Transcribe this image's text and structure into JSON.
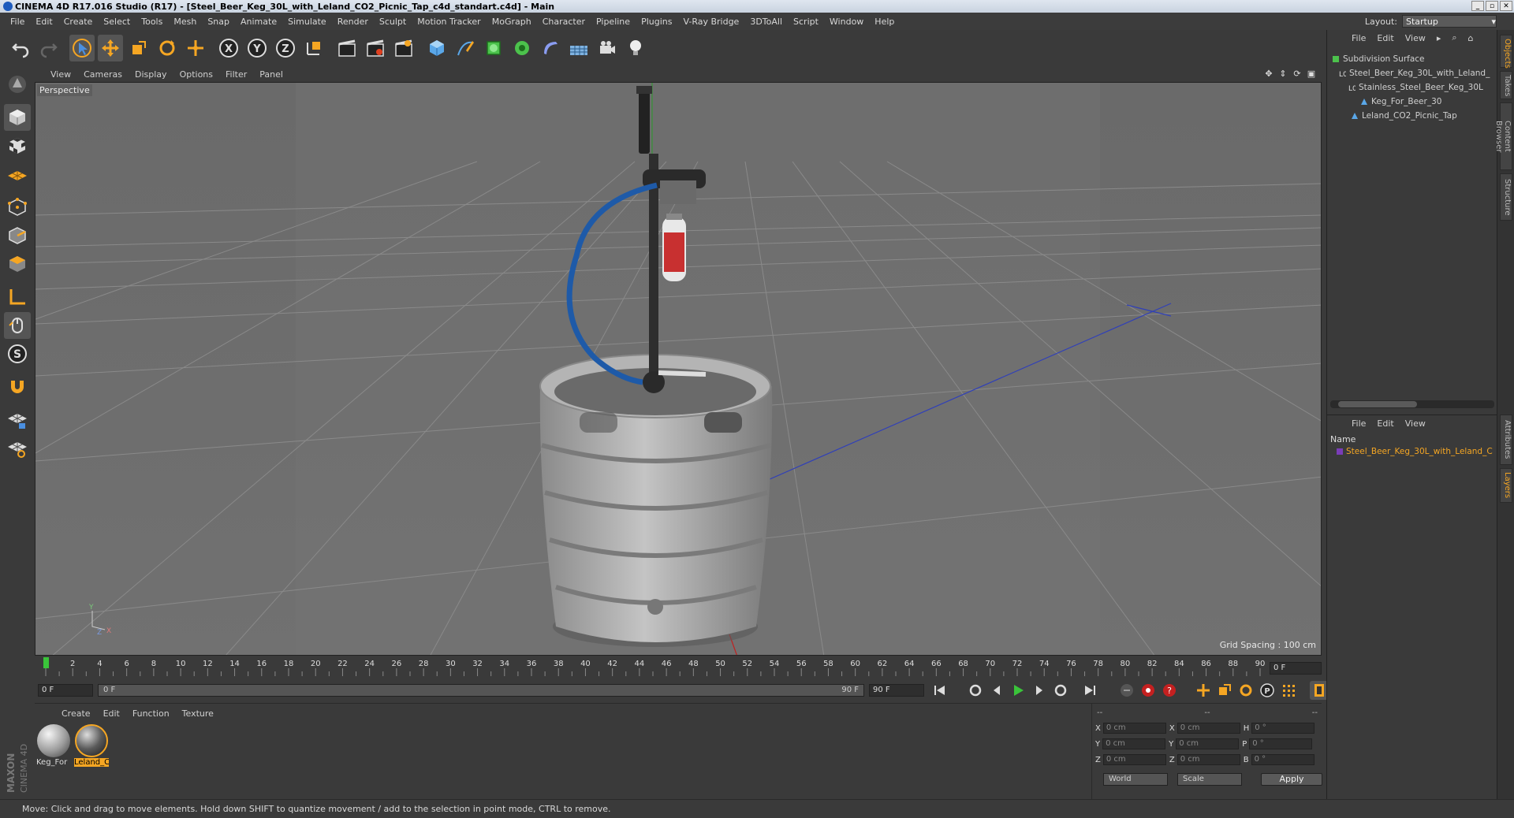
{
  "window": {
    "title": "CINEMA 4D R17.016 Studio (R17) - [Steel_Beer_Keg_30L_with_Leland_CO2_Picnic_Tap_c4d_standart.c4d] - Main"
  },
  "menubar": {
    "items": [
      "File",
      "Edit",
      "Create",
      "Select",
      "Tools",
      "Mesh",
      "Snap",
      "Animate",
      "Simulate",
      "Render",
      "Sculpt",
      "Motion Tracker",
      "MoGraph",
      "Character",
      "Pipeline",
      "Plugins",
      "V-Ray Bridge",
      "3DToAll",
      "Script",
      "Window",
      "Help"
    ],
    "layout_label": "Layout:",
    "layout_value": "Startup"
  },
  "viewport": {
    "menu": [
      "View",
      "Cameras",
      "Display",
      "Options",
      "Filter",
      "Panel"
    ],
    "camera_label": "Perspective",
    "grid_spacing": "Grid Spacing : 100 cm"
  },
  "timeline": {
    "ticks": [
      0,
      2,
      4,
      6,
      8,
      10,
      12,
      14,
      16,
      18,
      20,
      22,
      24,
      26,
      28,
      30,
      32,
      34,
      36,
      38,
      40,
      42,
      44,
      46,
      48,
      50,
      52,
      54,
      56,
      58,
      60,
      62,
      64,
      66,
      68,
      70,
      72,
      74,
      76,
      78,
      80,
      82,
      84,
      86,
      88,
      90
    ],
    "current_frame": "0 F"
  },
  "transport": {
    "start_frame": "0 F",
    "range_start": "0 F",
    "range_end": "90 F",
    "end_frame": "90 F"
  },
  "materials": {
    "menu": [
      "Create",
      "Edit",
      "Function",
      "Texture"
    ],
    "items": [
      {
        "label": "Keg_For"
      },
      {
        "label": "Leland_C"
      }
    ]
  },
  "coordinates": {
    "header": [
      "--",
      "--",
      "--"
    ],
    "rows": [
      {
        "a": "X",
        "av": "0 cm",
        "b": "X",
        "bv": "0 cm",
        "c": "H",
        "cv": "0 °"
      },
      {
        "a": "Y",
        "av": "0 cm",
        "b": "Y",
        "bv": "0 cm",
        "c": "P",
        "cv": "0 °"
      },
      {
        "a": "Z",
        "av": "0 cm",
        "b": "Z",
        "bv": "0 cm",
        "c": "B",
        "cv": "0 °"
      }
    ],
    "mode_world": "World",
    "mode_scale": "Scale",
    "apply": "Apply"
  },
  "object_manager": {
    "menu": [
      "File",
      "Edit",
      "View"
    ],
    "objects": [
      {
        "name": "Subdivision Surface"
      },
      {
        "name": "Steel_Beer_Keg_30L_with_Leland_"
      },
      {
        "name": "Stainless_Steel_Beer_Keg_30L"
      },
      {
        "name": "Keg_For_Beer_30"
      },
      {
        "name": "Leland_CO2_Picnic_Tap"
      }
    ]
  },
  "layer_manager": {
    "menu": [
      "File",
      "Edit",
      "View"
    ],
    "name_header": "Name",
    "layer": "Steel_Beer_Keg_30L_with_Leland_C"
  },
  "side_tabs": [
    "Objects",
    "Takes",
    "Content Browser",
    "Structure",
    "Attributes",
    "Layers"
  ],
  "statusbar": {
    "text": "Move: Click and drag to move elements. Hold down SHIFT to quantize movement / add to the selection in point mode, CTRL to remove."
  },
  "colors": {
    "accent": "#f5a623",
    "viewport_bg": "#6e6e6e",
    "panel_bg": "#3a3a3a"
  }
}
